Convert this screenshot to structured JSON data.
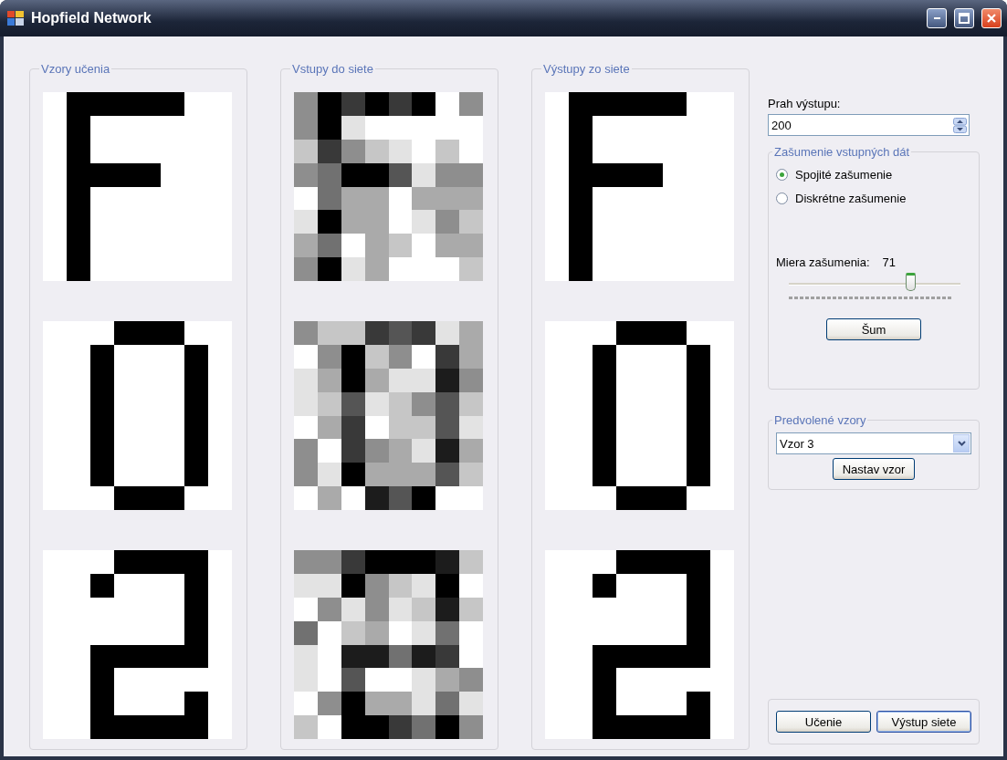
{
  "window": {
    "title": "Hopfield Network"
  },
  "pattern_groups": [
    {
      "label": "Vzory učenia"
    },
    {
      "label": "Vstupy do siete"
    },
    {
      "label": "Výstupy zo siete"
    }
  ],
  "threshold": {
    "label": "Prah výstupu:",
    "value": "200"
  },
  "noise_group": {
    "label": "Zašumenie vstupných dát",
    "options": [
      {
        "label": "Spojité zašumenie",
        "selected": true
      },
      {
        "label": "Diskrétne zašumenie",
        "selected": false
      }
    ],
    "amount_label": "Miera zašumenia:",
    "amount_value": "71",
    "slider": {
      "level": 0.71
    },
    "button": "Šum"
  },
  "presets": {
    "label": "Predvolené vzory",
    "value": "Vzor 3",
    "button": "Nastav vzor"
  },
  "actions": [
    "Učenie",
    "Výstup siete"
  ]
}
